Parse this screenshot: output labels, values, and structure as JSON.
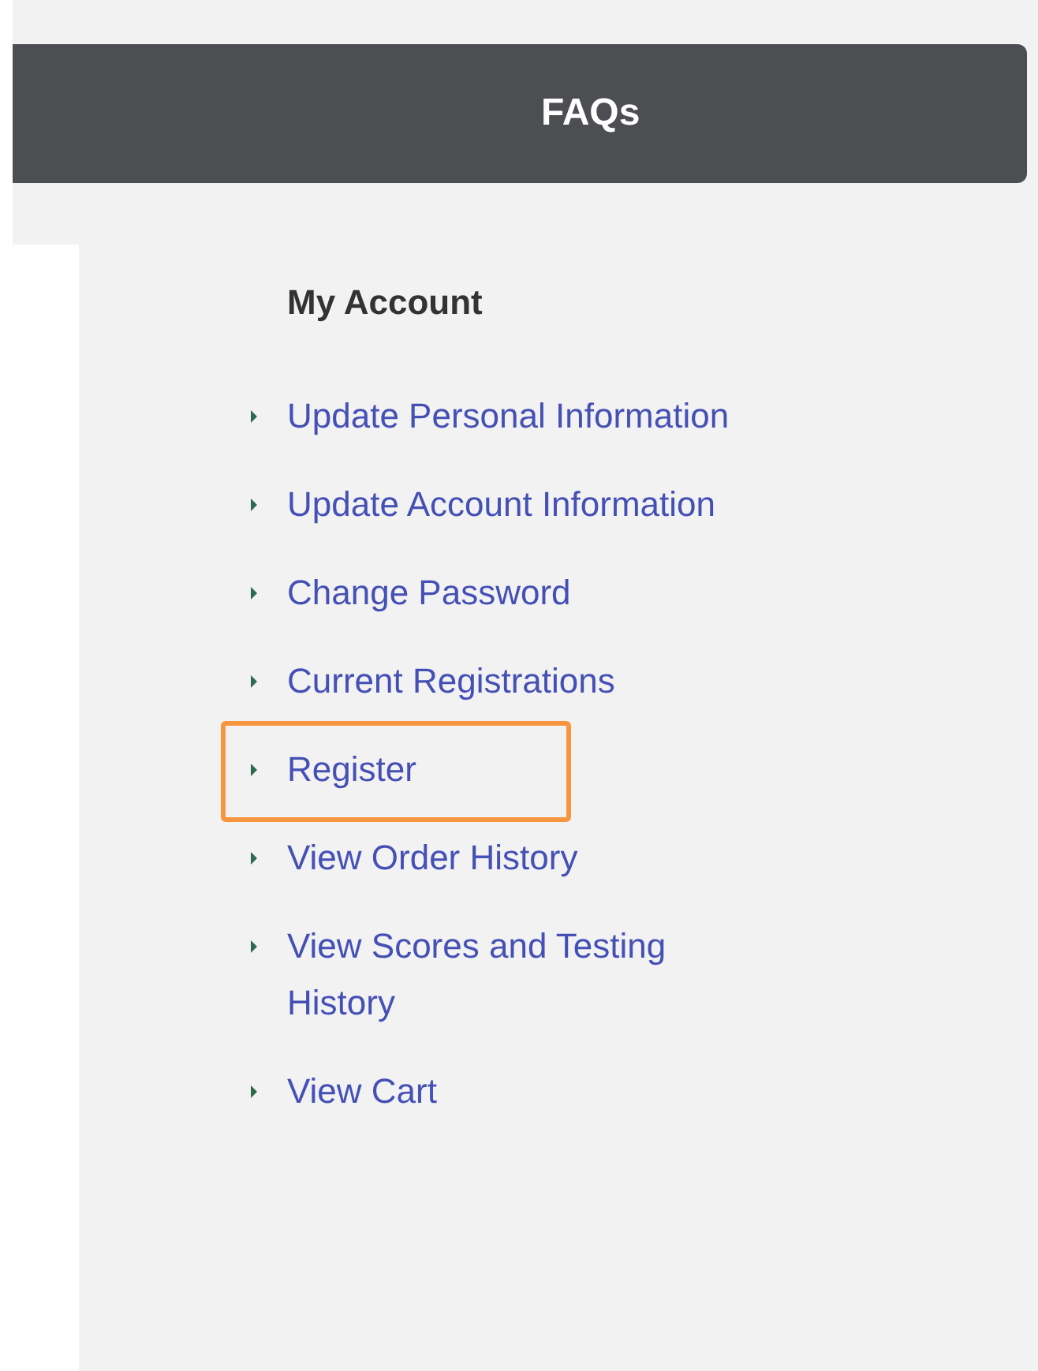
{
  "nav_bar": {
    "tab": "FAQs"
  },
  "sidebar": {
    "heading": "My Account",
    "items": [
      {
        "label": "Update Personal Information",
        "highlighted": false
      },
      {
        "label": "Update Account Information",
        "highlighted": false
      },
      {
        "label": "Change Password",
        "highlighted": false
      },
      {
        "label": "Current Registrations",
        "highlighted": false
      },
      {
        "label": "Register",
        "highlighted": true
      },
      {
        "label": "View Order History",
        "highlighted": false
      },
      {
        "label": "View Scores and Testing History",
        "highlighted": false
      },
      {
        "label": "View Cart",
        "highlighted": false
      }
    ]
  }
}
